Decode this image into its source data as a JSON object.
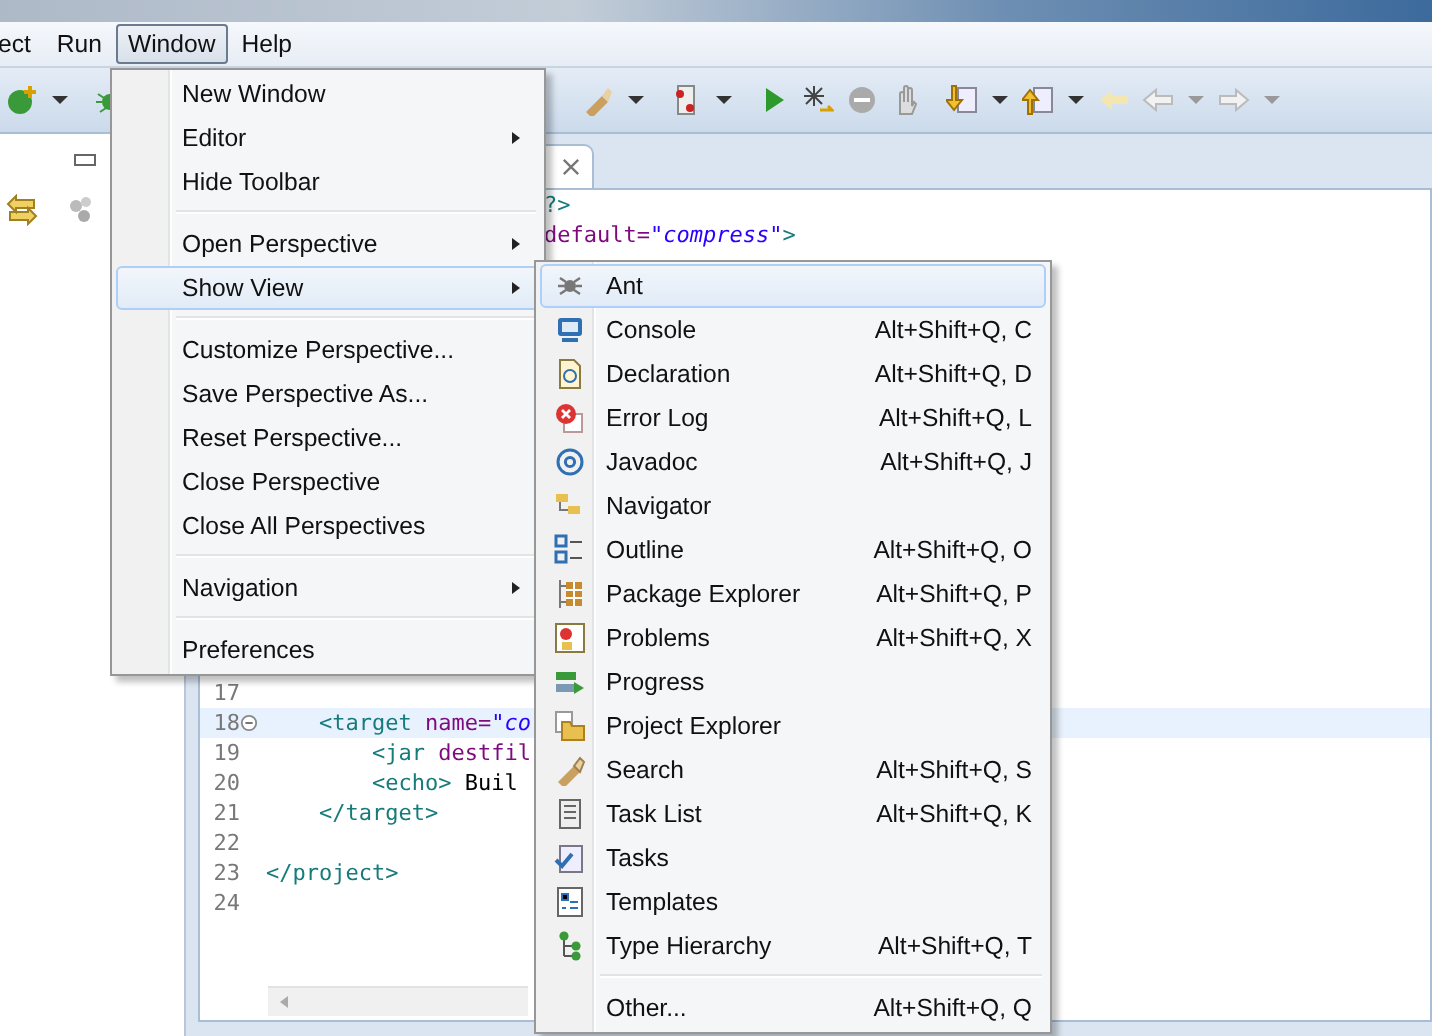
{
  "menu_bar": [
    {
      "label": "ect",
      "selected": false
    },
    {
      "label": "Run",
      "selected": false
    },
    {
      "label": "Window",
      "selected": true
    },
    {
      "label": "Help",
      "selected": false
    }
  ],
  "editor": {
    "top_fragments": [
      [
        {
          "t": "?>",
          "kind": "tag"
        }
      ],
      [
        {
          "t": "default=",
          "kind": "attr"
        },
        {
          "t": "\"compress\"",
          "kind": "string"
        },
        {
          "t": ">",
          "kind": "tag"
        }
      ]
    ],
    "lines": [
      {
        "number": "17",
        "fold": false,
        "current": false
      },
      {
        "number": "18",
        "fold": true,
        "current": true,
        "parts": [
          {
            "t": "    <target ",
            "kind": "tag"
          },
          {
            "t": "name=",
            "kind": "attr"
          },
          {
            "t": "\"co",
            "kind": "string"
          }
        ]
      },
      {
        "number": "19",
        "fold": false,
        "current": false,
        "parts": [
          {
            "t": "        <jar ",
            "kind": "tag"
          },
          {
            "t": "destfil",
            "kind": "attr"
          }
        ]
      },
      {
        "number": "20",
        "fold": false,
        "current": false,
        "parts": [
          {
            "t": "        <echo>",
            "kind": "tag"
          },
          {
            "t": " Buil",
            "kind": "text"
          }
        ]
      },
      {
        "number": "21",
        "fold": false,
        "current": false,
        "parts": [
          {
            "t": "    </target>",
            "kind": "tag"
          }
        ]
      },
      {
        "number": "22",
        "fold": false,
        "current": false
      },
      {
        "number": "23",
        "fold": false,
        "current": false,
        "parts": [
          {
            "t": "</project>",
            "kind": "tag"
          }
        ]
      },
      {
        "number": "24",
        "fold": false,
        "current": false
      }
    ]
  },
  "window_menu": {
    "items": [
      {
        "kind": "item",
        "label": "New Window",
        "submenu": false,
        "selected": false
      },
      {
        "kind": "item",
        "label": "Editor",
        "submenu": true,
        "selected": false
      },
      {
        "kind": "item",
        "label": "Hide Toolbar",
        "submenu": false,
        "selected": false
      },
      {
        "kind": "separator"
      },
      {
        "kind": "item",
        "label": "Open Perspective",
        "submenu": true,
        "selected": false
      },
      {
        "kind": "item",
        "label": "Show View",
        "submenu": true,
        "selected": true
      },
      {
        "kind": "separator"
      },
      {
        "kind": "item",
        "label": "Customize Perspective...",
        "submenu": false,
        "selected": false
      },
      {
        "kind": "item",
        "label": "Save Perspective As...",
        "submenu": false,
        "selected": false
      },
      {
        "kind": "item",
        "label": "Reset Perspective...",
        "submenu": false,
        "selected": false
      },
      {
        "kind": "item",
        "label": "Close Perspective",
        "submenu": false,
        "selected": false
      },
      {
        "kind": "item",
        "label": "Close All Perspectives",
        "submenu": false,
        "selected": false
      },
      {
        "kind": "separator"
      },
      {
        "kind": "item",
        "label": "Navigation",
        "submenu": true,
        "selected": false
      },
      {
        "kind": "separator"
      },
      {
        "kind": "item",
        "label": "Preferences",
        "submenu": false,
        "selected": false
      }
    ]
  },
  "show_view_menu": {
    "items": [
      {
        "kind": "item",
        "label": "Ant",
        "selected": true
      },
      {
        "kind": "item",
        "label": "Console",
        "shortcut": "Alt+Shift+Q, C",
        "selected": false
      },
      {
        "kind": "item",
        "label": "Declaration",
        "shortcut": "Alt+Shift+Q, D",
        "selected": false
      },
      {
        "kind": "item",
        "label": "Error Log",
        "shortcut": "Alt+Shift+Q, L",
        "selected": false
      },
      {
        "kind": "item",
        "label": "Javadoc",
        "shortcut": "Alt+Shift+Q, J",
        "selected": false
      },
      {
        "kind": "item",
        "label": "Navigator",
        "selected": false
      },
      {
        "kind": "item",
        "label": "Outline",
        "shortcut": "Alt+Shift+Q, O",
        "selected": false
      },
      {
        "kind": "item",
        "label": "Package Explorer",
        "shortcut": "Alt+Shift+Q, P",
        "selected": false
      },
      {
        "kind": "item",
        "label": "Problems",
        "shortcut": "Alt+Shift+Q, X",
        "selected": false
      },
      {
        "kind": "item",
        "label": "Progress",
        "selected": false
      },
      {
        "kind": "item",
        "label": "Project Explorer",
        "selected": false
      },
      {
        "kind": "item",
        "label": "Search",
        "shortcut": "Alt+Shift+Q, S",
        "selected": false
      },
      {
        "kind": "item",
        "label": "Task List",
        "shortcut": "Alt+Shift+Q, K",
        "selected": false
      },
      {
        "kind": "item",
        "label": "Tasks",
        "selected": false
      },
      {
        "kind": "item",
        "label": "Templates",
        "selected": false
      },
      {
        "kind": "item",
        "label": "Type Hierarchy",
        "shortcut": "Alt+Shift+Q, T",
        "selected": false
      },
      {
        "kind": "separator"
      },
      {
        "kind": "item",
        "label": "Other...",
        "shortcut": "Alt+Shift+Q, Q",
        "selected": false
      }
    ]
  }
}
